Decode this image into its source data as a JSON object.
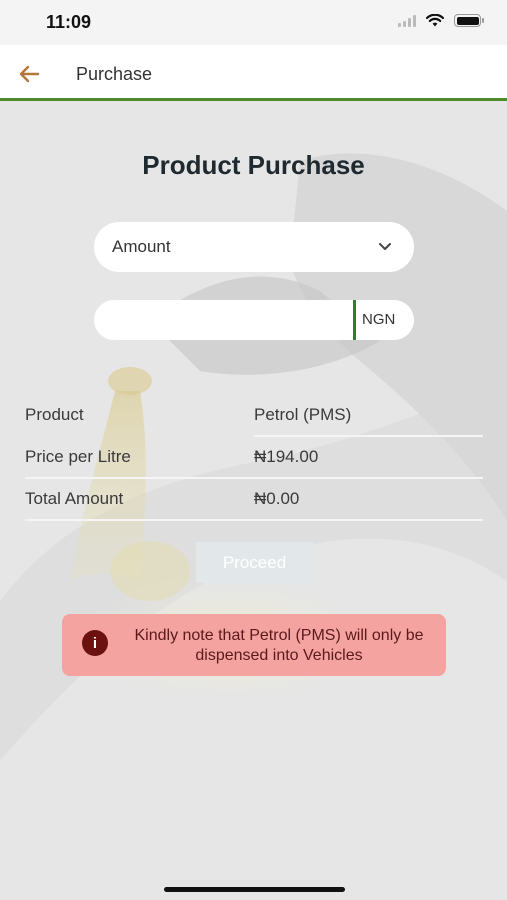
{
  "status_bar": {
    "time": "11:09"
  },
  "nav": {
    "title": "Purchase"
  },
  "page": {
    "title": "Product Purchase"
  },
  "form": {
    "type_select": {
      "value": "Amount"
    },
    "amount_input": {
      "value": "",
      "currency": "NGN"
    }
  },
  "details": [
    {
      "label": "Product",
      "value": "Petrol (PMS)"
    },
    {
      "label": "Price per Litre",
      "value": "₦194.00"
    },
    {
      "label": "Total Amount",
      "value": "₦0.00"
    }
  ],
  "actions": {
    "proceed_label": "Proceed"
  },
  "notice": {
    "icon": "i",
    "text": "Kindly note that Petrol (PMS) will only be dispensed into Vehicles"
  },
  "colors": {
    "accent": "#4e8a2a",
    "notice_bg": "#f4a3a1",
    "notice_icon": "#6b1110"
  }
}
